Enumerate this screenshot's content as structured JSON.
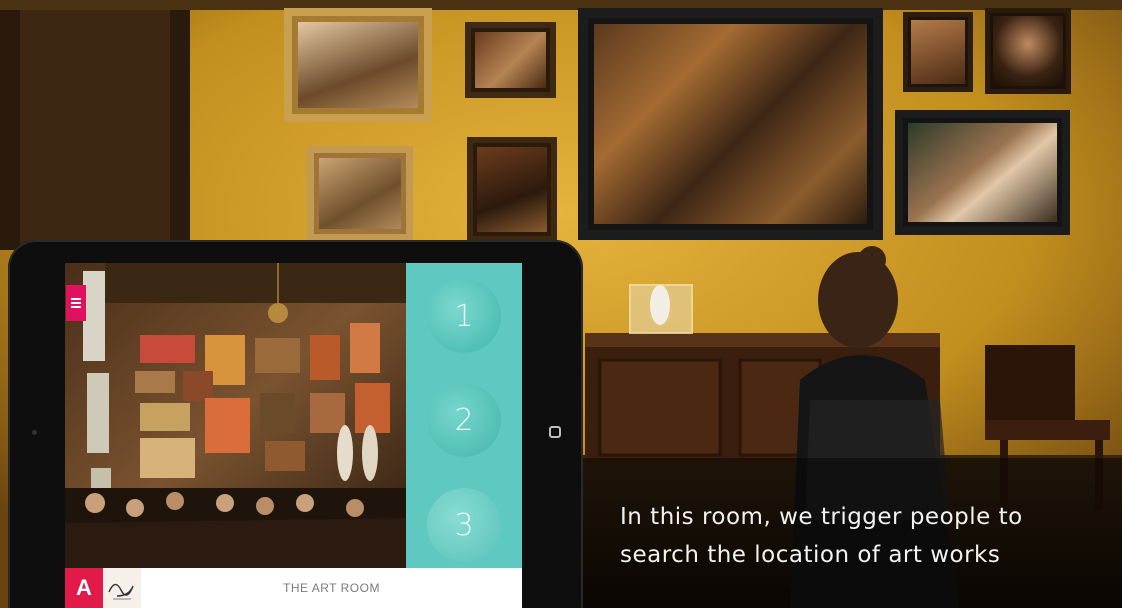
{
  "caption": {
    "line1": "In this room, we trigger people to",
    "line2": "search the location of art works"
  },
  "app": {
    "menu_icon": "hamburger-menu-icon",
    "room_numbers": [
      "1",
      "2",
      "3"
    ],
    "logo_letter": "A",
    "room_title": "THE ART ROOM",
    "accent_color": "#e0115f",
    "panel_color": "#5fc9c1"
  }
}
